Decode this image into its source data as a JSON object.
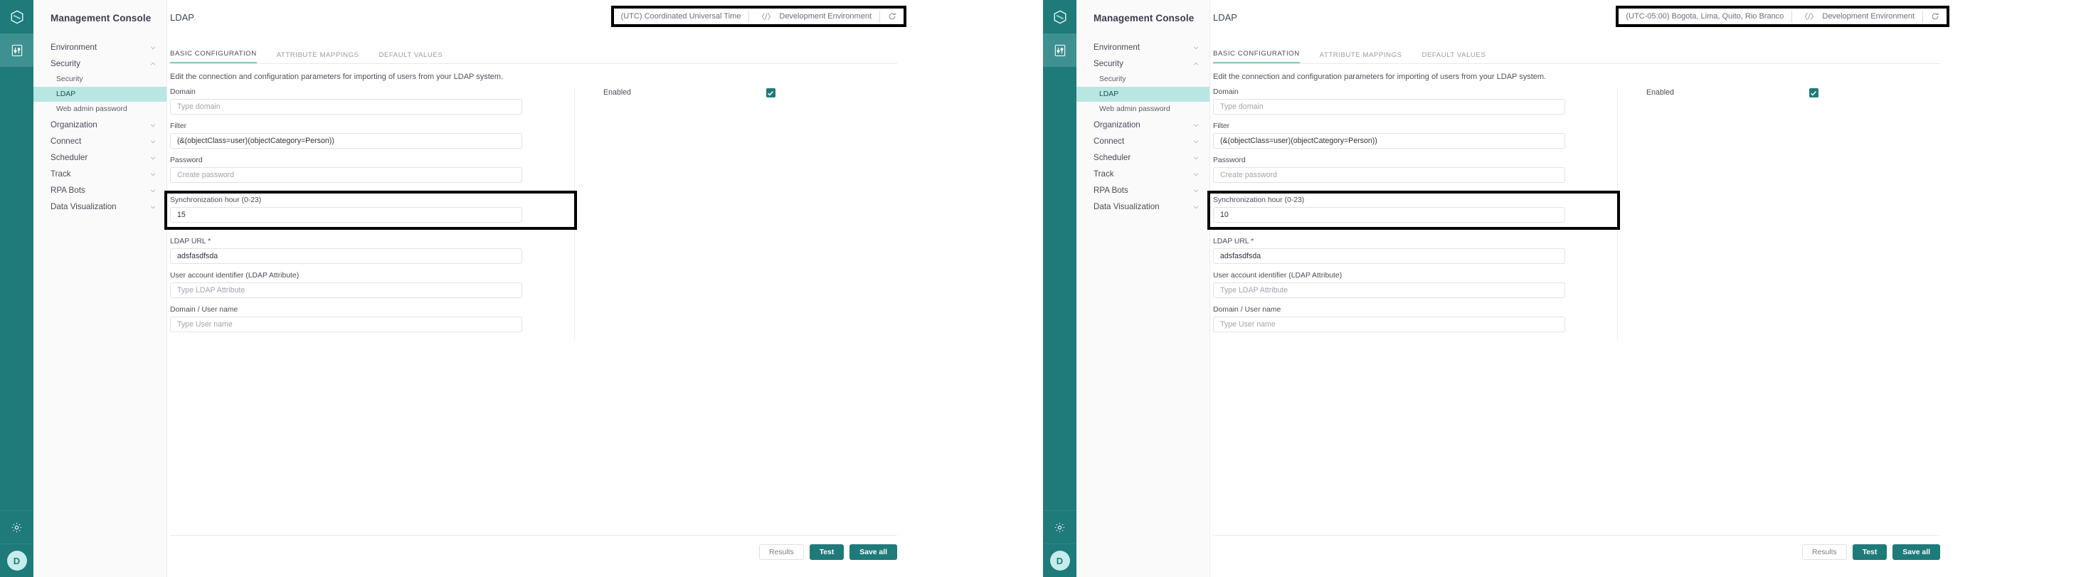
{
  "app": {
    "rail": {
      "logo_icon": "cube-logo-icon",
      "items": [
        {
          "icon": "sliders-icon",
          "active": true
        }
      ],
      "settings_icon": "gear-icon",
      "avatar_initial": "D"
    },
    "sidebar": {
      "title": "Management Console",
      "items": [
        {
          "label": "Environment",
          "type": "group",
          "expanded": false,
          "icon": "chevron-down-icon"
        },
        {
          "label": "Security",
          "type": "group",
          "expanded": true,
          "icon": "chevron-up-icon"
        },
        {
          "label": "Security",
          "type": "sub",
          "active": false
        },
        {
          "label": "LDAP",
          "type": "sub",
          "active": true
        },
        {
          "label": "Web admin password",
          "type": "sub",
          "active": false
        },
        {
          "label": "Organization",
          "type": "group",
          "expanded": false,
          "icon": "chevron-down-icon"
        },
        {
          "label": "Connect",
          "type": "group",
          "expanded": false,
          "icon": "chevron-down-icon"
        },
        {
          "label": "Scheduler",
          "type": "group",
          "expanded": false,
          "icon": "chevron-down-icon"
        },
        {
          "label": "Track",
          "type": "group",
          "expanded": false,
          "icon": "chevron-down-icon"
        },
        {
          "label": "RPA Bots",
          "type": "group",
          "expanded": false,
          "icon": "chevron-down-icon"
        },
        {
          "label": "Data Visualization",
          "type": "group",
          "expanded": false,
          "icon": "chevron-down-icon"
        }
      ]
    },
    "colors": {
      "brand_teal": "#1f7a7a",
      "rail_active": "#3f9191",
      "nav_active_bg": "#b8e6e3",
      "tab_underline": "#8cc4c0",
      "highlight_outline": "#000000"
    }
  },
  "panels": [
    {
      "id": "panel-before",
      "page_title": "LDAP",
      "env_bar": {
        "timezone": "(UTC) Coordinated Universal Time",
        "code_glyph": "〈/〉",
        "environment": "Development Environment",
        "refresh_icon": "refresh-icon",
        "highlighted": true
      },
      "tabs": [
        {
          "label": "BASIC CONFIGURATION",
          "active": true
        },
        {
          "label": "ATTRIBUTE MAPPINGS",
          "active": false
        },
        {
          "label": "DEFAULT VALUES",
          "active": false
        }
      ],
      "description": "Edit the connection and configuration parameters for importing of users from your LDAP system.",
      "fields": [
        {
          "label": "Domain",
          "value": "",
          "placeholder": "Type domain",
          "highlighted": false
        },
        {
          "label": "Filter",
          "value": "(&(objectClass=user)(objectCategory=Person))",
          "placeholder": "",
          "highlighted": false
        },
        {
          "label": "Password",
          "value": "",
          "placeholder": "Create password",
          "highlighted": false
        },
        {
          "label": "Synchronization hour (0-23)",
          "value": "15",
          "placeholder": "",
          "highlighted": true
        },
        {
          "label": "LDAP URL *",
          "value": "adsfasdfsda",
          "placeholder": "",
          "highlighted": false
        },
        {
          "label": "User account identifier (LDAP Attribute)",
          "value": "",
          "placeholder": "Type LDAP Attribute",
          "highlighted": false
        },
        {
          "label": "Domain / User name",
          "value": "",
          "placeholder": "Type User name",
          "highlighted": false
        }
      ],
      "enabled": {
        "label": "Enabled",
        "checked": true,
        "icon": "check-icon"
      },
      "buttons": [
        {
          "label": "Results",
          "style": "ghost"
        },
        {
          "label": "Test",
          "style": "solid"
        },
        {
          "label": "Save all",
          "style": "solid"
        }
      ]
    },
    {
      "id": "panel-after",
      "page_title": "LDAP",
      "env_bar": {
        "timezone": "(UTC-05:00) Bogota, Lima, Quito, Rio Branco",
        "code_glyph": "〈/〉",
        "environment": "Development Environment",
        "refresh_icon": "refresh-icon",
        "highlighted": true
      },
      "tabs": [
        {
          "label": "BASIC CONFIGURATION",
          "active": true
        },
        {
          "label": "ATTRIBUTE MAPPINGS",
          "active": false
        },
        {
          "label": "DEFAULT VALUES",
          "active": false
        }
      ],
      "description": "Edit the connection and configuration parameters for importing of users from your LDAP system.",
      "fields": [
        {
          "label": "Domain",
          "value": "",
          "placeholder": "Type domain",
          "highlighted": false
        },
        {
          "label": "Filter",
          "value": "(&(objectClass=user)(objectCategory=Person))",
          "placeholder": "",
          "highlighted": false
        },
        {
          "label": "Password",
          "value": "",
          "placeholder": "Create password",
          "highlighted": false
        },
        {
          "label": "Synchronization hour (0-23)",
          "value": "10",
          "placeholder": "",
          "highlighted": true
        },
        {
          "label": "LDAP URL *",
          "value": "adsfasdfsda",
          "placeholder": "",
          "highlighted": false
        },
        {
          "label": "User account identifier (LDAP Attribute)",
          "value": "",
          "placeholder": "Type LDAP Attribute",
          "highlighted": false
        },
        {
          "label": "Domain / User name",
          "value": "",
          "placeholder": "Type User name",
          "highlighted": false
        }
      ],
      "enabled": {
        "label": "Enabled",
        "checked": true,
        "icon": "check-icon"
      },
      "buttons": [
        {
          "label": "Results",
          "style": "ghost"
        },
        {
          "label": "Test",
          "style": "solid"
        },
        {
          "label": "Save all",
          "style": "solid"
        }
      ]
    }
  ]
}
